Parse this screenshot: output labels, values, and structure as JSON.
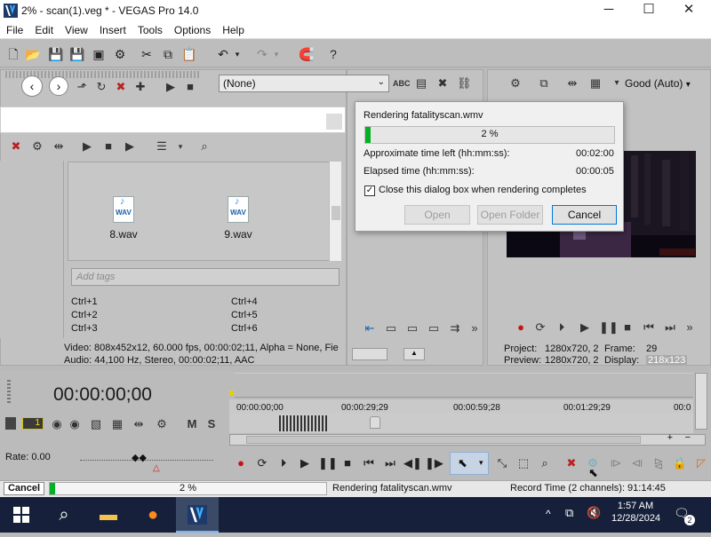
{
  "window": {
    "title": "2% - scan(1).veg * - VEGAS Pro 14.0",
    "minimize": "─",
    "maximize": "☐",
    "close": "✕"
  },
  "menu": [
    "File",
    "Edit",
    "View",
    "Insert",
    "Tools",
    "Options",
    "Help"
  ],
  "trimmer": {
    "fx_select": "(None)"
  },
  "explorer": {
    "files": [
      {
        "name": "8.wav",
        "type": "WAV"
      },
      {
        "name": "9.wav",
        "type": "WAV"
      }
    ],
    "tag_placeholder": "Add tags",
    "shortcuts_left": [
      "Ctrl+1",
      "Ctrl+2",
      "Ctrl+3"
    ],
    "shortcuts_right": [
      "Ctrl+4",
      "Ctrl+5",
      "Ctrl+6"
    ],
    "media_info_video": "Video: 808x452x12, 60.000 fps, 00:00:02;11, Alpha = None, Fie",
    "media_info_audio": "Audio: 44,100 Hz, Stereo, 00:00:02;11, AAC"
  },
  "preview": {
    "quality": "Good (Auto)",
    "project_label": "Project:",
    "project_value": "1280x720, 2",
    "preview_label": "Preview:",
    "preview_value": "1280x720, 2",
    "frame_label": "Frame:",
    "frame_value": "29",
    "display_label": "Display:",
    "display_value": "218x123"
  },
  "render_dialog": {
    "title": "Rendering fatalityscan.wmv",
    "progress_text": "2 %",
    "progress": 0.02,
    "time_left_label": "Approximate time left (hh:mm:ss):",
    "time_left_value": "00:02:00",
    "elapsed_label": "Elapsed time (hh:mm:ss):",
    "elapsed_value": "00:00:05",
    "close_checkbox_label": "Close this dialog box when rendering completes",
    "close_checked": true,
    "open_button": "Open",
    "open_folder_button": "Open Folder",
    "cancel_button": "Cancel"
  },
  "timeline": {
    "timecode": "00:00:00;00",
    "ruler": [
      "00:00:00;00",
      "00:00:29;29",
      "00:00:59;28",
      "00:01:29;29",
      "00:0"
    ],
    "track_number": "1",
    "rate_label": "Rate: 0.00"
  },
  "status": {
    "cancel": "Cancel",
    "progress_text": "2 %",
    "progress": 0.02,
    "message": "Rendering fatalityscan.wmv",
    "record_time": "Record Time (2 channels): 91:14:45"
  },
  "taskbar": {
    "time": "1:57 AM",
    "date": "12/28/2024",
    "notification_count": "2"
  }
}
